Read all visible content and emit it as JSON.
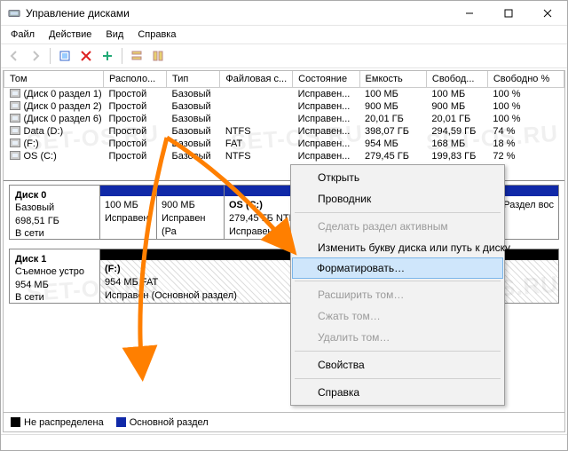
{
  "window": {
    "title": "Управление дисками"
  },
  "menu": {
    "file": "Файл",
    "action": "Действие",
    "view": "Вид",
    "help": "Справка"
  },
  "table": {
    "headers": {
      "volume": "Том",
      "layout": "Располо...",
      "type": "Тип",
      "fs": "Файловая с...",
      "status": "Состояние",
      "capacity": "Емкость",
      "free": "Свобод...",
      "freepct": "Свободно %"
    },
    "rows": [
      {
        "vol": "(Диск 0 раздел 1)",
        "layout": "Простой",
        "type": "Базовый",
        "fs": "",
        "status": "Исправен...",
        "cap": "100 МБ",
        "free": "100 МБ",
        "pct": "100 %"
      },
      {
        "vol": "(Диск 0 раздел 2)",
        "layout": "Простой",
        "type": "Базовый",
        "fs": "",
        "status": "Исправен...",
        "cap": "900 МБ",
        "free": "900 МБ",
        "pct": "100 %"
      },
      {
        "vol": "(Диск 0 раздел 6)",
        "layout": "Простой",
        "type": "Базовый",
        "fs": "",
        "status": "Исправен...",
        "cap": "20,01 ГБ",
        "free": "20,01 ГБ",
        "pct": "100 %"
      },
      {
        "vol": "Data (D:)",
        "layout": "Простой",
        "type": "Базовый",
        "fs": "NTFS",
        "status": "Исправен...",
        "cap": "398,07 ГБ",
        "free": "294,59 ГБ",
        "pct": "74 %"
      },
      {
        "vol": "(F:)",
        "layout": "Простой",
        "type": "Базовый",
        "fs": "FAT",
        "status": "Исправен...",
        "cap": "954 МБ",
        "free": "168 МБ",
        "pct": "18 %"
      },
      {
        "vol": "OS (C:)",
        "layout": "Простой",
        "type": "Базовый",
        "fs": "NTFS",
        "status": "Исправен...",
        "cap": "279,45 ГБ",
        "free": "199,83 ГБ",
        "pct": "72 %"
      }
    ]
  },
  "graph": {
    "disk0": {
      "name": "Диск 0",
      "kind": "Базовый",
      "size": "698,51 ГБ",
      "state": "В сети",
      "p1": {
        "size": "100 МБ",
        "status": "Исправен"
      },
      "p2": {
        "size": "900 МБ",
        "status": "Исправен (Ра"
      },
      "p3": {
        "name": "OS (C:)",
        "size": "279,45 ГБ NTFS",
        "status": "Исправен (За"
      },
      "p4": {
        "status": "н (Раздел вос"
      }
    },
    "disk1": {
      "name": "Диск 1",
      "kind": "Съемное устро",
      "size": "954 МБ",
      "state": "В сети",
      "p1": {
        "name": "(F:)",
        "size": "954 МБ FAT",
        "status": "Исправен (Основной раздел)"
      }
    }
  },
  "legend": {
    "unalloc": "Не распределена",
    "primary": "Основной раздел"
  },
  "context": {
    "open": "Открыть",
    "explorer": "Проводник",
    "active": "Сделать раздел активным",
    "letter": "Изменить букву диска или путь к диску…",
    "format": "Форматировать…",
    "extend": "Расширить том…",
    "shrink": "Сжать том…",
    "delete": "Удалить том…",
    "props": "Свойства",
    "help": "Справка"
  },
  "watermark": "SET-OS.RU"
}
